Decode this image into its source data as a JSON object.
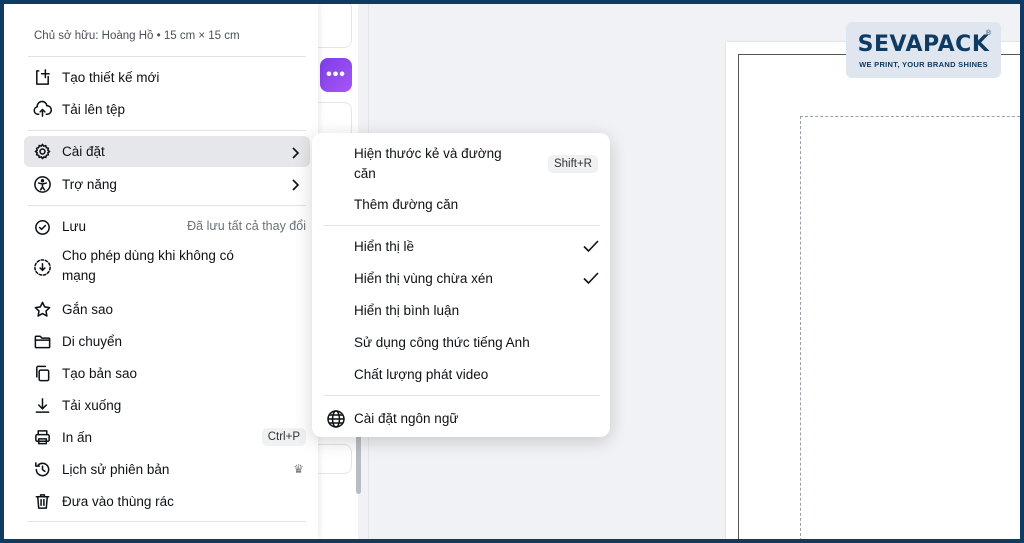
{
  "brand": {
    "logo_text": "SEVAPACK",
    "logo_tagline": "WE PRINT, YOUR BRAND SHINES",
    "logo_reg": "®",
    "color": "#0f3b63"
  },
  "toolbar": {
    "more_label": "•••"
  },
  "menu": {
    "owner_info": "Chủ sở hữu: Hoàng Hồ • 15 cm × 15 cm",
    "items": [
      {
        "label": "Tạo thiết kế mới",
        "icon": "plus-page-icon"
      },
      {
        "label": "Tải lên tệp",
        "icon": "cloud-upload-icon"
      },
      {
        "label": "Cài đặt",
        "icon": "gear-icon",
        "active": true
      },
      {
        "label": "Trợ năng",
        "icon": "accessibility-icon"
      },
      {
        "label": "Lưu",
        "icon": "cloud-check-icon",
        "status": "Đã lưu tất cả thay đổi"
      },
      {
        "label": "Cho phép dùng khi không có mạng",
        "icon": "offline-icon"
      },
      {
        "label": "Gắn sao",
        "icon": "star-icon"
      },
      {
        "label": "Di chuyển",
        "icon": "folder-icon"
      },
      {
        "label": "Tạo bản sao",
        "icon": "copy-icon"
      },
      {
        "label": "Tải xuống",
        "icon": "download-icon"
      },
      {
        "label": "In ấn",
        "icon": "printer-icon",
        "shortcut": "Ctrl+P"
      },
      {
        "label": "Lịch sử phiên bản",
        "icon": "history-icon",
        "badge": "crown-icon"
      },
      {
        "label": "Đưa vào thùng rác",
        "icon": "trash-icon"
      }
    ]
  },
  "submenu": {
    "items": [
      {
        "label": "Hiện thước kẻ và đường căn",
        "shortcut": "Shift+R"
      },
      {
        "label": "Thêm đường căn"
      },
      {
        "label": "Hiển thị lề",
        "checked": true
      },
      {
        "label": "Hiển thị vùng chừa xén",
        "checked": true
      },
      {
        "label": "Hiển thị bình luận"
      },
      {
        "label": "Sử dụng công thức tiếng Anh"
      },
      {
        "label": "Chất lượng phát video"
      },
      {
        "label": "Cài đặt ngôn ngữ",
        "icon": "globe-icon"
      }
    ]
  }
}
